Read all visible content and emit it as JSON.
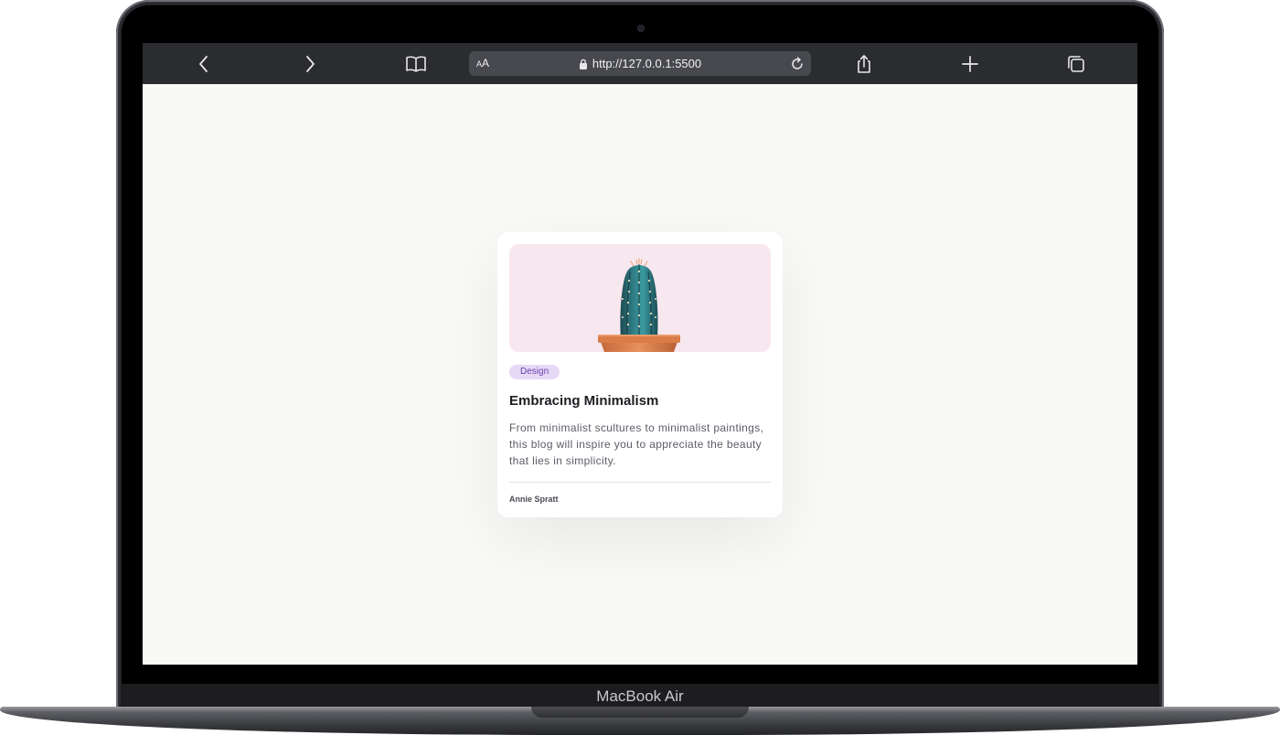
{
  "device": {
    "brand_label": "MacBook Air"
  },
  "browser": {
    "url": "http://127.0.0.1:5500",
    "reader_label_small": "A",
    "reader_label_large": "A",
    "icons": {
      "back": "chevron-left-icon",
      "forward": "chevron-right-icon",
      "bookmarks": "book-icon",
      "lock": "lock-icon",
      "reload": "reload-icon",
      "share": "share-icon",
      "new_tab": "plus-icon",
      "tabs": "tabs-icon"
    }
  },
  "card": {
    "image_alt": "cactus-in-pot",
    "badge": "Design",
    "title": "Embracing Minimalism",
    "description": "From minimalist scultures to minimalist paintings, this blog will inspire you to appreciate the beauty that lies in simplicity.",
    "author": "Annie Spratt"
  },
  "colors": {
    "badge_bg": "#e6d9f6",
    "badge_text": "#6a3fb0",
    "image_bg": "#f7e7ef",
    "page_bg": "#f9f9f7",
    "toolbar_bg": "#2b2c30"
  }
}
